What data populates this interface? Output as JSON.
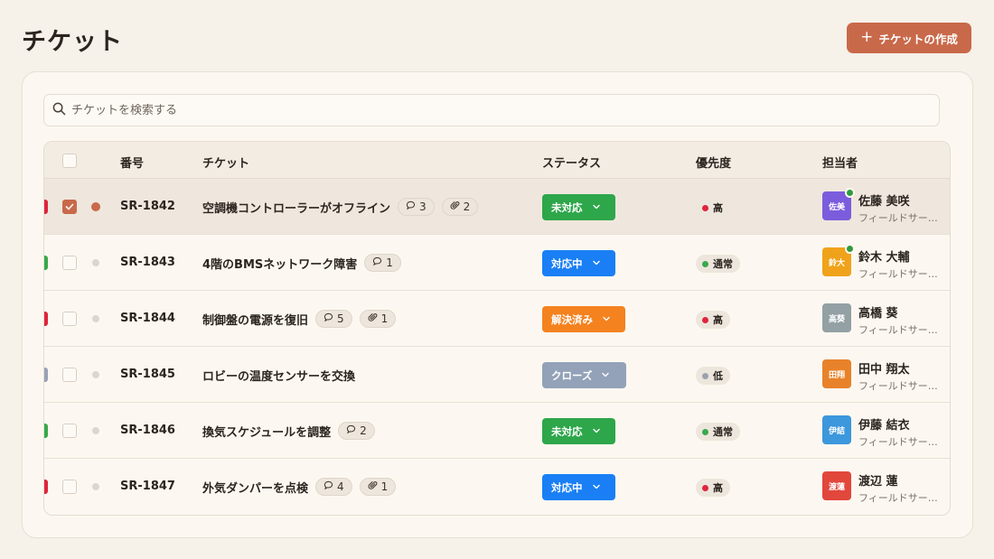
{
  "header": {
    "title": "チケット",
    "create_label": "チケットの作成",
    "create_icon": "plus-icon"
  },
  "search": {
    "placeholder": "チケットを検索する",
    "icon": "search-icon"
  },
  "columns": {
    "number": "番号",
    "ticket": "チケット",
    "status": "ステータス",
    "priority": "優先度",
    "assignee": "担当者"
  },
  "colors": {
    "accent": "#c8694a",
    "open": "#2ea64a",
    "in_progress": "#1a7ff5",
    "resolved": "#f4821f",
    "closed": "#93a2b8"
  },
  "rows": [
    {
      "id": "SR-1842",
      "title": "空調機コントローラーがオフライン",
      "comments": "3",
      "attachments": "2",
      "status": "未対応",
      "status_color": "#2ea64a",
      "priority": "高",
      "priority_color": "#e0243c",
      "accent": "#e0243c",
      "assignee": "佐藤 美咲",
      "initials": "佐美",
      "avatar_color": "#7b5cdc",
      "online": true,
      "role": "フィールドサー…",
      "selected": true
    },
    {
      "id": "SR-1843",
      "title": "4階のBMSネットワーク障害",
      "comments": "1",
      "attachments": null,
      "status": "対応中",
      "status_color": "#1a7ff5",
      "priority": "通常",
      "priority_color": "#3aa94b",
      "accent": "#3aa94b",
      "assignee": "鈴木 大輔",
      "initials": "鈴大",
      "avatar_color": "#f0a21a",
      "online": true,
      "role": "フィールドサー…",
      "selected": false
    },
    {
      "id": "SR-1844",
      "title": "制御盤の電源を復旧",
      "comments": "5",
      "attachments": "1",
      "status": "解決済み",
      "status_color": "#f4821f",
      "priority": "高",
      "priority_color": "#e0243c",
      "accent": "#e0243c",
      "assignee": "高橋 葵",
      "initials": "高葵",
      "avatar_color": "#93a0a4",
      "online": false,
      "role": "フィールドサー…",
      "selected": false
    },
    {
      "id": "SR-1845",
      "title": "ロビーの温度センサーを交換",
      "comments": null,
      "attachments": null,
      "status": "クローズ",
      "status_color": "#93a2b8",
      "priority": "低",
      "priority_color": "#9aa3ad",
      "accent": "#9aa3b5",
      "assignee": "田中 翔太",
      "initials": "田翔",
      "avatar_color": "#e8822a",
      "online": false,
      "role": "フィールドサー…",
      "selected": false
    },
    {
      "id": "SR-1846",
      "title": "換気スケジュールを調整",
      "comments": "2",
      "attachments": null,
      "status": "未対応",
      "status_color": "#2ea64a",
      "priority": "通常",
      "priority_color": "#3aa94b",
      "accent": "#3aa94b",
      "assignee": "伊藤 結衣",
      "initials": "伊結",
      "avatar_color": "#3c97dc",
      "online": false,
      "role": "フィールドサー…",
      "selected": false
    },
    {
      "id": "SR-1847",
      "title": "外気ダンパーを点検",
      "comments": "4",
      "attachments": "1",
      "status": "対応中",
      "status_color": "#1a7ff5",
      "priority": "高",
      "priority_color": "#e0243c",
      "accent": "#e0243c",
      "assignee": "渡辺 蓮",
      "initials": "渡蓮",
      "avatar_color": "#e2473c",
      "online": false,
      "role": "フィールドサー…",
      "selected": false
    }
  ]
}
